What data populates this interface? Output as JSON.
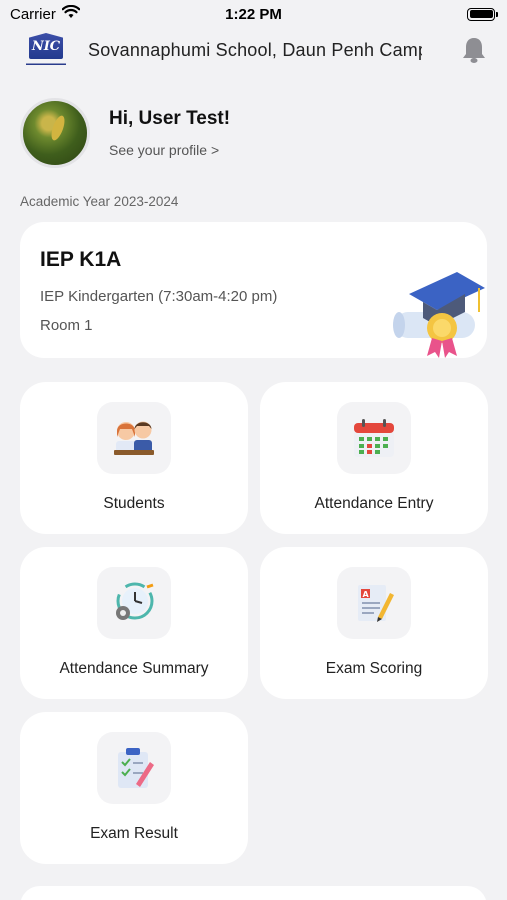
{
  "status_bar": {
    "carrier": "Carrier",
    "time": "1:22 PM"
  },
  "header": {
    "logo_text": "NIC",
    "school_name": "Sovannaphumi School, Daun Penh Campus",
    "logo_icon": "school-logo",
    "notification_icon": "bell-icon"
  },
  "profile": {
    "greeting": "Hi, User Test!",
    "link_label": "See your profile >"
  },
  "academic_year": "Academic Year 2023-2024",
  "class_card": {
    "name": "IEP K1A",
    "program": "IEP Kindergarten (7:30am-4:20 pm)",
    "room": "Room 1"
  },
  "menu": [
    {
      "label": "Students",
      "icon": "students-icon"
    },
    {
      "label": "Attendance Entry",
      "icon": "calendar-icon"
    },
    {
      "label": "Attendance Summary",
      "icon": "clock-gear-icon"
    },
    {
      "label": "Exam Scoring",
      "icon": "exam-pencil-icon"
    },
    {
      "label": "Exam Result",
      "icon": "clipboard-checklist-icon"
    }
  ],
  "colors": {
    "background": "#f2f2f4",
    "card": "#ffffff",
    "primary_text": "#111111",
    "secondary_text": "#555555"
  }
}
